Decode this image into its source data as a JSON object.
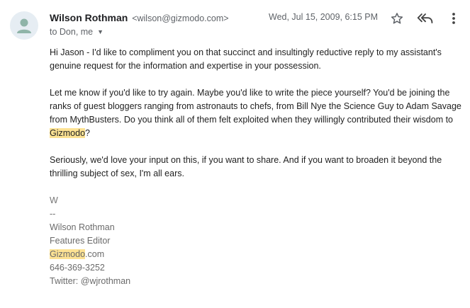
{
  "header": {
    "sender_name": "Wilson Rothman",
    "sender_email": "<wilson@gizmodo.com>",
    "recipients": "to Don, me",
    "date": "Wed, Jul 15, 2009, 6:15 PM",
    "icons": [
      "person-avatar-icon",
      "star-icon",
      "reply-all-icon",
      "more-vert-icon",
      "chevron-down-icon"
    ]
  },
  "body": {
    "para1": "Hi Jason - I'd like to compliment you on that succinct and insultingly reductive reply to my assistant's genuine request for the information and expertise in your possession.",
    "para2_before": "Let me know if you'd like to try again. Maybe you'd like to write the piece yourself? You'd be joining the ranks of guest bloggers ranging from astronauts to chefs, from Bill Nye the Science Guy to Adam Savage from MythBusters. Do you think all of them felt exploited when they willingly contributed their wisdom to ",
    "para2_highlight": "Gizmodo",
    "para2_after": "?",
    "para3": "Seriously, we'd love your input on this, if you want to share. And if you want to broaden it beyond the thrilling subject of sex, I'm all ears."
  },
  "signature": {
    "initial": "W",
    "dashes": "--",
    "name": "Wilson Rothman",
    "title": "Features Editor",
    "site_highlight": "Gizmodo",
    "site_rest": ".com",
    "phone": "646-369-3252",
    "twitter": "Twitter: @wjrothman"
  },
  "colors": {
    "highlight": "#fde293",
    "muted": "#5f6368",
    "text": "#222222"
  }
}
